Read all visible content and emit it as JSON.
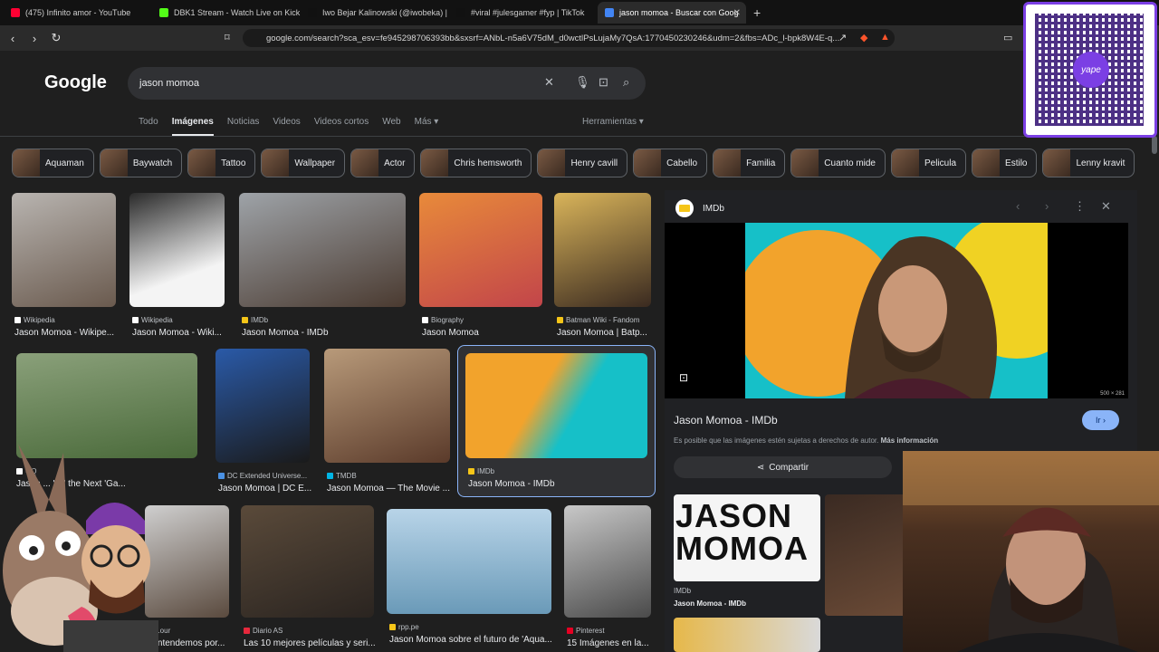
{
  "browser": {
    "tabs": [
      {
        "label": "(475) Infinito amor - YouTube",
        "color": "#ff0033",
        "active": false
      },
      {
        "label": "DBK1 Stream - Watch Live on Kick",
        "color": "#53fc18",
        "active": false
      },
      {
        "label": "Iwo Bejar Kalinowski (@iwobeka) | Ti",
        "color": "#111111",
        "active": false
      },
      {
        "label": "#viral #julesgamer #fyp | TikTok",
        "color": "#111111",
        "active": false
      },
      {
        "label": "jason momoa - Buscar con Goog",
        "color": "#4285f4",
        "active": true
      }
    ],
    "url": "google.com/search?sca_esv=fe945298706393bb&sxsrf=ANbL-n5a6V75dM_d0wctlPsLujaMy7QsA:1770450230246&udm=2&fbs=ADc_l-bpk8W4E-q..."
  },
  "google": {
    "logo": "Google",
    "query": "jason momoa",
    "tabs": [
      "Todo",
      "Imágenes",
      "Noticias",
      "Videos",
      "Videos cortos",
      "Web",
      "Más ▾"
    ],
    "tools": "Herramientas ▾",
    "chips": [
      "Aquaman",
      "Baywatch",
      "Tattoo",
      "Wallpaper",
      "Actor",
      "Chris hemsworth",
      "Henry cavill",
      "Cabello",
      "Familia",
      "Cuanto mide",
      "Pelicula",
      "Estilo",
      "Lenny kravit"
    ]
  },
  "results": [
    {
      "source": "Wikipedia",
      "title": "Jason Momoa - Wikipe...",
      "color": "#ffffff"
    },
    {
      "source": "Wikipedia",
      "title": "Jason Momoa - Wiki...",
      "color": "#ffffff"
    },
    {
      "source": "IMDb",
      "title": "Jason Momoa - IMDb",
      "color": "#f5c518"
    },
    {
      "source": "Biography",
      "title": "Jason Momoa",
      "color": "#ffffff"
    },
    {
      "source": "Batman Wiki - Fandom",
      "title": "Jason Momoa | Batp...",
      "color": "#f5c518"
    },
    {
      "source": "GQ",
      "title": "Jason ... 'Ar' the Next 'Ga...",
      "color": "#ffffff"
    },
    {
      "source": "DC Extended Universe...",
      "title": "Jason Momoa | DC E...",
      "color": "#4a90e2"
    },
    {
      "source": "TMDB",
      "title": "Jason Momoa — The Movie ...",
      "color": "#01b4e4"
    },
    {
      "source": "IMDb",
      "title": "Jason Momoa - IMDb",
      "color": "#f5c518"
    },
    {
      "source": "...our",
      "title": "...entendemos por...",
      "color": "#ffffff"
    },
    {
      "source": "Diario AS",
      "title": "Las 10 mejores películas y seri...",
      "color": "#e6283c"
    },
    {
      "source": "rpp.pe",
      "title": "Jason Momoa sobre el futuro de 'Aqua...",
      "color": "#f5c518"
    },
    {
      "source": "Pinterest",
      "title": "15 Imágenes en la...",
      "color": "#e60023"
    }
  ],
  "panel": {
    "site": "IMDb",
    "title": "Jason Momoa - IMDb",
    "go": "Ir ›",
    "note": "Es posible que las imágenes estén sujetas a derechos de autor.",
    "more": "Más información",
    "share": "Compartir",
    "size": "500 × 281",
    "related": {
      "headline": "JASON MOMOA",
      "source": "IMDb",
      "title": "Jason Momoa - IMDb"
    }
  },
  "overlay": {
    "qr_brand": "yape"
  }
}
